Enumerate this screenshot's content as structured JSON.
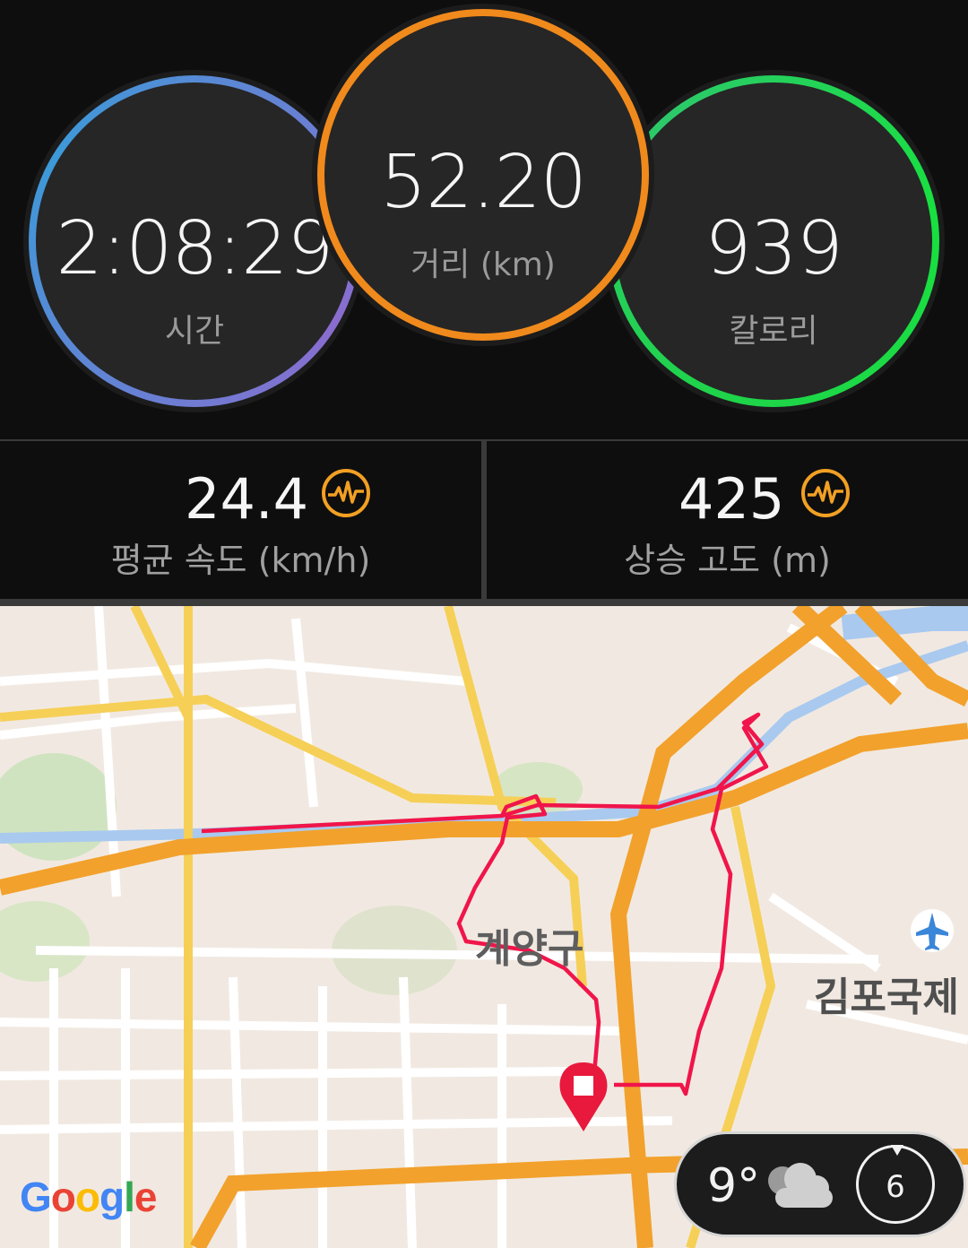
{
  "summary": {
    "time": {
      "value": "2:08:29",
      "label": "시간",
      "color": "#3c9ad9"
    },
    "distance": {
      "value": "52.20",
      "label": "거리 (km)",
      "color": "#f08a1c"
    },
    "calories": {
      "value": "939",
      "label": "칼로리",
      "color": "#1fd44a"
    }
  },
  "stats": {
    "avg_speed": {
      "value": "24.4",
      "label": "평균 속도 (km/h)",
      "icon": "pulse-icon"
    },
    "elevation_gain": {
      "value": "425",
      "label": "상승 고도 (m)",
      "icon": "pulse-icon"
    }
  },
  "map": {
    "district_label": "계양구",
    "airport_label": "김포국제",
    "attribution": "Google",
    "route_color": "#f0154a",
    "end_marker_icon": "stop-marker-icon"
  },
  "weather": {
    "temperature": "9°",
    "condition_icon": "cloud-icon",
    "uv_index": "6"
  }
}
